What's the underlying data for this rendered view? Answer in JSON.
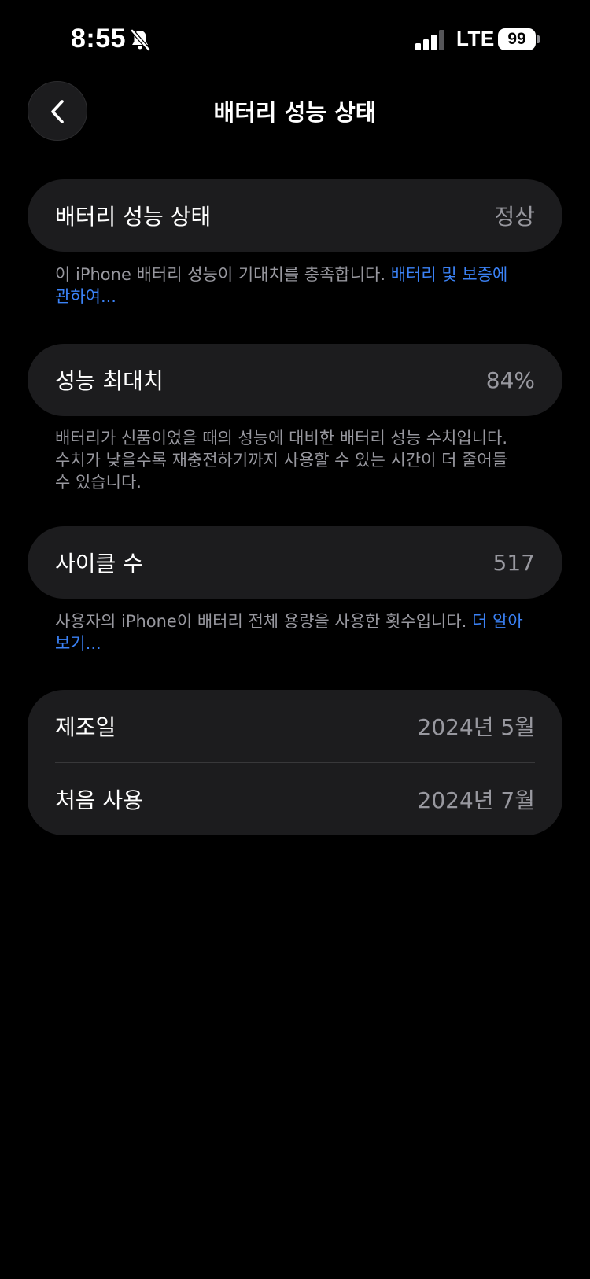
{
  "status_bar": {
    "time": "8:55",
    "network": "LTE",
    "battery_level": "99",
    "icons": [
      "bell-slash-icon",
      "cellular-signal-icon",
      "battery-icon"
    ]
  },
  "nav": {
    "title": "배터리 성능 상태",
    "back_icon": "chevron-left-icon"
  },
  "sections": {
    "health": {
      "label": "배터리 성능 상태",
      "value": "정상",
      "footnote_text": "이 iPhone 배터리 성능이 기대치를 충족합니다. ",
      "footnote_link": "배터리 및 보증에 관하여..."
    },
    "max_capacity": {
      "label": "성능 최대치",
      "value": "84%",
      "footnote_text": "배터리가 신품이었을 때의 성능에 대비한 배터리 성능 수치입니다. 수치가 낮을수록 재충전하기까지 사용할 수 있는 시간이 더 줄어들 수 있습니다."
    },
    "cycle_count": {
      "label": "사이클 수",
      "value": "517",
      "footnote_text": "사용자의 iPhone이 배터리 전체 용량을 사용한 횟수입니다. ",
      "footnote_link": "더 알아보기..."
    },
    "dates": {
      "manufacture_label": "제조일",
      "manufacture_value": "2024년 5월",
      "first_use_label": "처음 사용",
      "first_use_value": "2024년 7월"
    }
  },
  "colors": {
    "background": "#000000",
    "card": "#1c1c1e",
    "secondary_text": "#98989f",
    "link": "#3b82f6"
  }
}
